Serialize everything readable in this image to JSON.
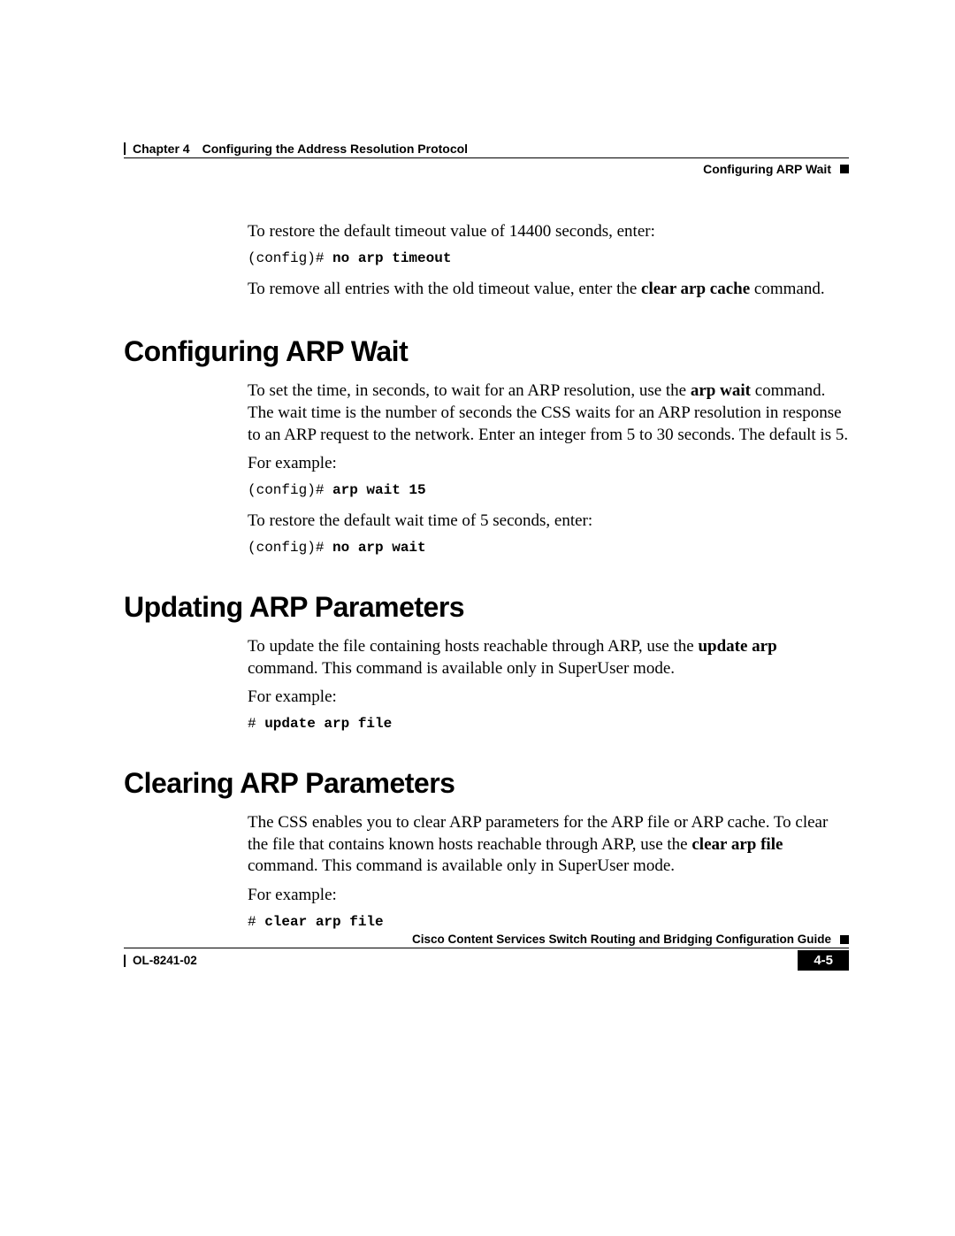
{
  "header": {
    "chapter_label": "Chapter 4",
    "chapter_title": "Configuring the Address Resolution Protocol",
    "section_ref": "Configuring ARP Wait"
  },
  "intro": {
    "p1": "To restore the default timeout value of 14400 seconds, enter:",
    "code1_prompt": "(config)# ",
    "code1_cmd": "no arp timeout",
    "p2a": "To remove all entries with the old timeout value, enter the ",
    "p2_bold": "clear arp cache",
    "p2b": " command."
  },
  "s1": {
    "heading": "Configuring ARP Wait",
    "p1a": "To set the time, in seconds, to wait for an ARP resolution, use the ",
    "p1_bold": "arp wait",
    "p1b": " command. The wait time is the number of seconds the CSS waits for an ARP resolution in response to an ARP request to the network. Enter an integer from 5 to 30 seconds. The default is 5.",
    "p2": "For example:",
    "code1_prompt": "(config)# ",
    "code1_cmd": "arp wait 15",
    "p3": "To restore the default wait time of 5 seconds, enter:",
    "code2_prompt": "(config)# ",
    "code2_cmd": "no arp wait"
  },
  "s2": {
    "heading": "Updating ARP Parameters",
    "p1a": "To update the file containing hosts reachable through ARP, use the ",
    "p1_bold": "update arp",
    "p1b": " command. This command is available only in SuperUser mode.",
    "p2": "For example:",
    "code1_prompt": "# ",
    "code1_cmd": "update arp file"
  },
  "s3": {
    "heading": "Clearing ARP Parameters",
    "p1a": "The CSS enables you to clear ARP parameters for the ARP file or ARP cache. To clear the file that contains known hosts reachable through ARP, use the ",
    "p1_bold": "clear arp file",
    "p1b": " command. This command is available only in SuperUser mode.",
    "p2": "For example:",
    "code1_prompt": "# ",
    "code1_cmd": "clear arp file"
  },
  "footer": {
    "guide_title": "Cisco Content Services Switch Routing and Bridging Configuration Guide",
    "doc_id": "OL-8241-02",
    "page_num": "4-5"
  }
}
